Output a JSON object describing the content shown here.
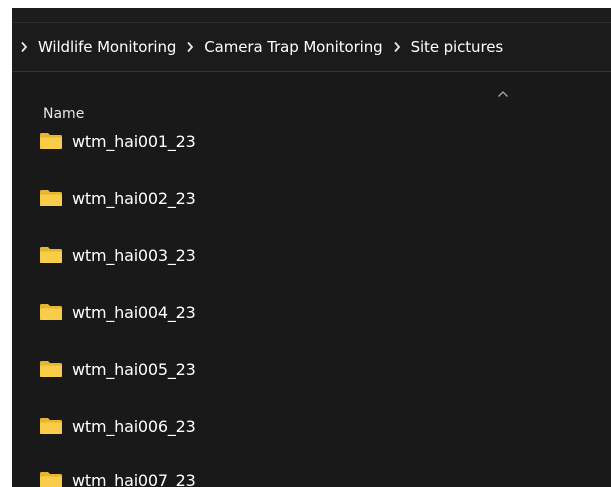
{
  "breadcrumb": {
    "items": [
      {
        "label": "Wildlife Monitoring"
      },
      {
        "label": "Camera Trap Monitoring"
      },
      {
        "label": "Site pictures"
      }
    ]
  },
  "list": {
    "column_header": "Name",
    "sort_icon": "chevron-up-icon",
    "folders": [
      {
        "name": "wtm_hai001_23",
        "icon": "folder-icon"
      },
      {
        "name": "wtm_hai002_23",
        "icon": "folder-icon"
      },
      {
        "name": "wtm_hai003_23",
        "icon": "folder-icon"
      },
      {
        "name": "wtm_hai004_23",
        "icon": "folder-icon"
      },
      {
        "name": "wtm_hai005_23",
        "icon": "folder-icon"
      },
      {
        "name": "wtm_hai006_23",
        "icon": "folder-icon"
      },
      {
        "name": "wtm_hai007_23",
        "icon": "folder-icon"
      }
    ]
  },
  "colors": {
    "background": "#191919",
    "text": "#ffffff",
    "folder": "#f5c542"
  }
}
